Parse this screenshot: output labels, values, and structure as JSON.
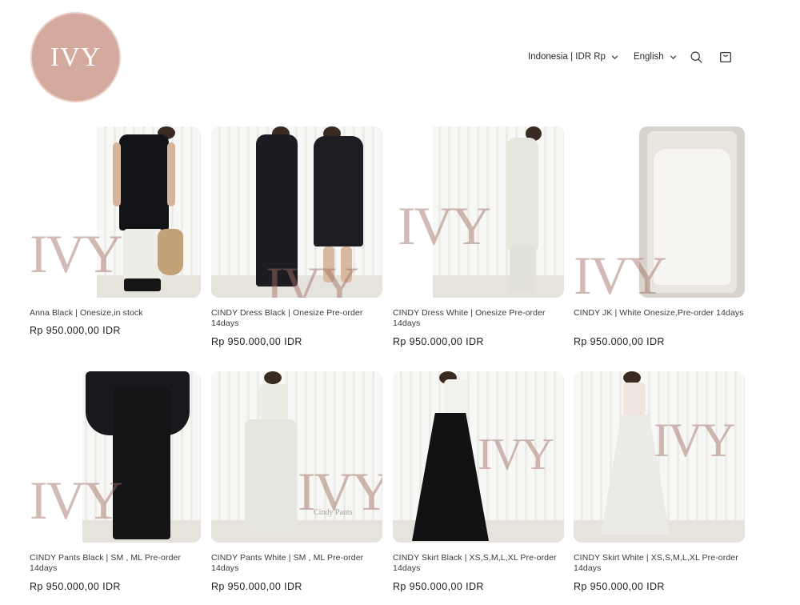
{
  "header": {
    "logo_text": "IVY",
    "country_currency": "Indonesia | IDR Rp",
    "language": "English",
    "icons": {
      "search": "search-icon",
      "cart": "cart-icon",
      "chevron": "chevron-down-icon"
    }
  },
  "watermark_text": "IVY",
  "products": [
    {
      "title": "Anna Black | Onesize,in stock",
      "price": "Rp 950.000,00 IDR"
    },
    {
      "title": "CINDY Dress Black | Onesize Pre-order 14days",
      "price": "Rp 950.000,00 IDR"
    },
    {
      "title": "CINDY Dress White | Onesize Pre-order 14days",
      "price": "Rp 950.000,00 IDR"
    },
    {
      "title": "CINDY JK | White Onesize,Pre-order 14days",
      "price": "Rp 950.000,00 IDR"
    },
    {
      "title": "CINDY Pants Black | SM , ML Pre-order 14days",
      "price": "Rp 950.000,00 IDR"
    },
    {
      "title": "CINDY Pants White | SM , ML Pre-order 14days",
      "price": "Rp 950.000,00 IDR",
      "image_caption": "Cindy Pants"
    },
    {
      "title": "CINDY Skirt Black | XS,S,M,L,XL Pre-order 14days",
      "price": "Rp 950.000,00 IDR"
    },
    {
      "title": "CINDY Skirt White | XS,S,M,L,XL Pre-order 14days",
      "price": "Rp 950.000,00 IDR"
    }
  ],
  "colors": {
    "logo_bg": "#d4aa9e",
    "watermark": "#a06e64",
    "text": "#121212"
  }
}
